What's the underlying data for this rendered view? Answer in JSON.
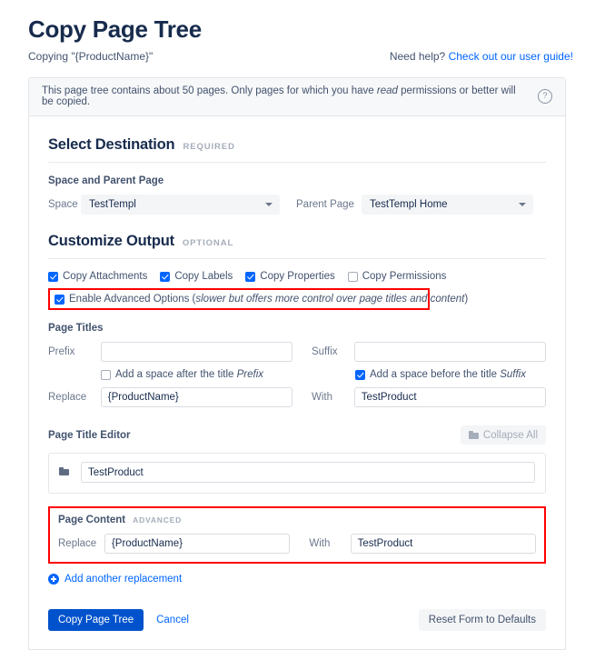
{
  "header": {
    "title": "Copy Page Tree",
    "copying_text": "Copying \"{ProductName}\"",
    "help_prefix": "Need help?",
    "help_link": "Check out our user guide!"
  },
  "info_banner": {
    "text_before_em": "This page tree contains about 50 pages. Only pages for which you have ",
    "em": "read",
    "text_after_em": " permissions or better will be copied.",
    "help_icon": "question-circle-icon",
    "help_icon_glyph": "?"
  },
  "select_destination": {
    "title": "Select Destination",
    "tag": "REQUIRED",
    "group_label": "Space and Parent Page",
    "space_label": "Space",
    "space_value": "TestTempl",
    "parent_label": "Parent Page",
    "parent_value": "TestTempl Home"
  },
  "customize_output": {
    "title": "Customize Output",
    "tag": "OPTIONAL",
    "checkboxes": [
      {
        "label": "Copy Attachments",
        "checked": true
      },
      {
        "label": "Copy Labels",
        "checked": true
      },
      {
        "label": "Copy Properties",
        "checked": true
      },
      {
        "label": "Copy Permissions",
        "checked": false
      }
    ],
    "advanced": {
      "checked": true,
      "label_main": "Enable Advanced Options (",
      "label_em": "slower but offers more control over page titles and content",
      "label_end": ")",
      "highlighted": true,
      "highlight_color": "#ff0000"
    }
  },
  "page_titles": {
    "group_label": "Page Titles",
    "prefix_label": "Prefix",
    "prefix_value": "",
    "prefix_placeholder": "",
    "suffix_label": "Suffix",
    "suffix_value": "",
    "suffix_placeholder": "",
    "space_after_prefix": {
      "label_main": "Add a space after the title ",
      "label_em": "Prefix",
      "checked": false
    },
    "space_before_suffix": {
      "label_main": "Add a space before the title ",
      "label_em": "Suffix",
      "checked": true
    },
    "replace_label": "Replace",
    "replace_value": "{ProductName}",
    "with_label": "With",
    "with_value": "TestProduct"
  },
  "page_title_editor": {
    "group_label": "Page Title Editor",
    "collapse_label": "Collapse All",
    "collapse_icon": "folder-icon",
    "row_icon": "folder-icon",
    "row_value": "TestProduct"
  },
  "page_content": {
    "title": "Page Content",
    "tag": "ADVANCED",
    "replace_label": "Replace",
    "replace_value": "{ProductName}",
    "with_label": "With",
    "with_value": "TestProduct",
    "highlighted": true,
    "highlight_color": "#ff0000",
    "add_link": "Add another replacement",
    "add_icon": "plus-circle-icon"
  },
  "footer": {
    "submit_label": "Copy Page Tree",
    "cancel_label": "Cancel",
    "reset_label": "Reset Form to Defaults"
  },
  "theme": {
    "primary": "#0052cc",
    "link": "#0065ff",
    "text": "#42526e",
    "heading": "#172b4d",
    "muted": "#a5adba"
  }
}
